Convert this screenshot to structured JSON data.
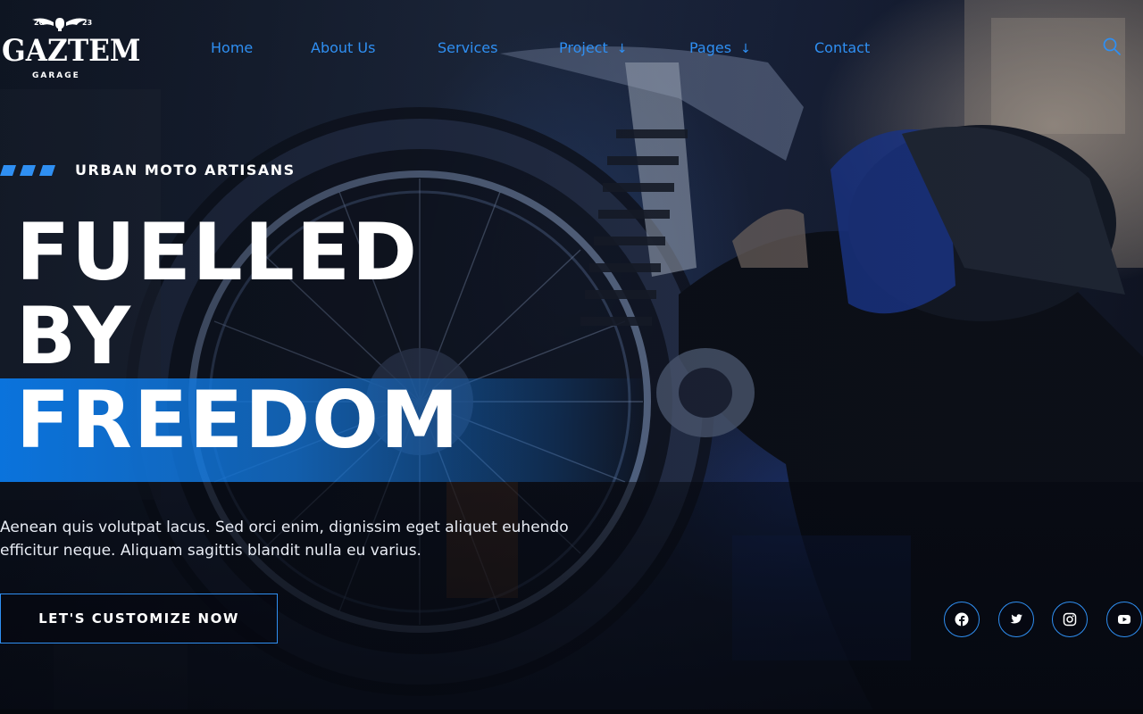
{
  "brand": {
    "name": "GAZTEM",
    "subtitle": "GARAGE",
    "year_left": "20",
    "year_right": "23"
  },
  "nav": {
    "items": [
      {
        "label": "Home",
        "has_dropdown": false
      },
      {
        "label": "About Us",
        "has_dropdown": false
      },
      {
        "label": "Services",
        "has_dropdown": false
      },
      {
        "label": "Project",
        "has_dropdown": true
      },
      {
        "label": "Pages",
        "has_dropdown": true
      },
      {
        "label": "Contact",
        "has_dropdown": false
      }
    ],
    "dropdown_arrow": "↓",
    "search_icon": "search-icon"
  },
  "hero": {
    "eyebrow": "URBAN MOTO ARTISANS",
    "headline": [
      "FUELLED",
      "BY",
      "FREEDOM"
    ],
    "description": "Aenean quis volutpat lacus. Sed orci enim, dignissim eget aliquet euhendo efficitur neque. Aliquam sagittis blandit nulla eu varius.",
    "cta_label": "LET'S CUSTOMIZE NOW"
  },
  "social": [
    "facebook-icon",
    "twitter-icon",
    "instagram-icon",
    "youtube-icon"
  ],
  "colors": {
    "accent": "#2f8ff2",
    "headline_band": "#0a78e6",
    "text": "#ffffff"
  }
}
